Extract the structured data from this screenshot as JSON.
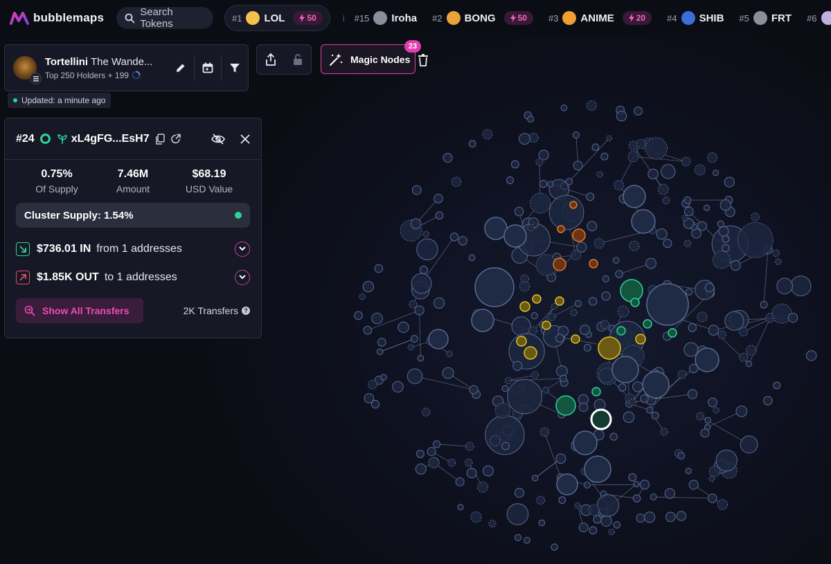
{
  "app": {
    "name": "bubblemaps"
  },
  "search": {
    "label": "Search Tokens"
  },
  "trending": [
    {
      "rank": "#1",
      "name": "LOL",
      "boost": "50",
      "icon": "laughing-face-icon",
      "color": "#f2c14e"
    },
    {
      "rank": "#15",
      "name": "Iroha",
      "boost": "",
      "icon": "iroha-token-icon",
      "color": "#8a8f9c"
    },
    {
      "rank": "#2",
      "name": "BONG",
      "boost": "50",
      "icon": "bong-token-icon",
      "color": "#e8a33a"
    },
    {
      "rank": "#3",
      "name": "ANIME",
      "boost": "20",
      "icon": "anime-token-icon",
      "color": "#f0a030"
    },
    {
      "rank": "#4",
      "name": "SHIB",
      "boost": "",
      "icon": "shib-token-icon",
      "color": "#3a6fd8"
    },
    {
      "rank": "#5",
      "name": "FRT",
      "boost": "",
      "icon": "frt-token-icon",
      "color": "#8c8f99"
    },
    {
      "rank": "#6",
      "name": "",
      "boost": "",
      "icon": "token-icon",
      "color": "#c0b0e0"
    }
  ],
  "separator": "i",
  "token": {
    "name": "Tortellini",
    "full_name": "The Wande...",
    "subtitle": "Top 250 Holders + 199",
    "chain_icon": "solana-icon",
    "updated": "Updated: a minute ago"
  },
  "magic_nodes": {
    "label": "Magic Nodes",
    "count": "23"
  },
  "detail": {
    "rank": "#24",
    "address": "xL4gFG...EsH7",
    "stats": [
      {
        "value": "0.75%",
        "label": "Of Supply"
      },
      {
        "value": "7.46M",
        "label": "Amount"
      },
      {
        "value": "$68.19",
        "label": "USD Value"
      }
    ],
    "cluster": "Cluster Supply: 1.54%",
    "in": {
      "amount": "$736.01 IN",
      "text": "from 1 addresses"
    },
    "out": {
      "amount": "$1.85K OUT",
      "text": "to 1 addresses"
    },
    "show_all": "Show All Transfers",
    "transfers": "2K Transfers",
    "help": "?"
  },
  "colors": {
    "accent": "#e23fae",
    "green": "#2ed39a",
    "node_fill": "#1c2740",
    "node_stroke": "#5a6a92",
    "orange": "#e07a2a",
    "yellow": "#e3c027",
    "in_green": "#2ed39a",
    "out_red": "#e8496a"
  }
}
